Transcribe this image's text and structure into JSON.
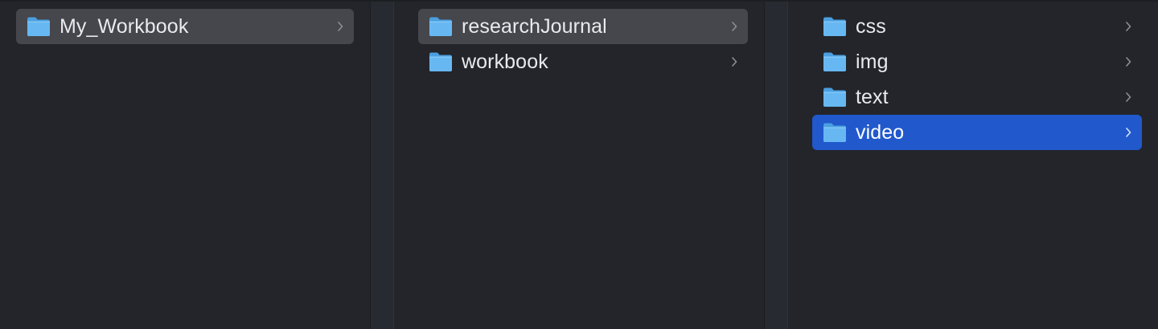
{
  "columns": [
    {
      "items": [
        {
          "label": "My_Workbook",
          "state": "selected-inactive"
        }
      ]
    },
    {
      "items": [
        {
          "label": "researchJournal",
          "state": "selected-inactive"
        },
        {
          "label": "workbook",
          "state": "normal"
        }
      ]
    },
    {
      "items": [
        {
          "label": "css",
          "state": "normal"
        },
        {
          "label": "img",
          "state": "normal"
        },
        {
          "label": "text",
          "state": "normal"
        },
        {
          "label": "video",
          "state": "selected-active"
        }
      ]
    }
  ],
  "colors": {
    "background": "#23252b",
    "selection_active": "#2159cc",
    "selection_inactive": "#45474c",
    "folder_icon": "#5fb3ef",
    "text": "#e9eaec"
  },
  "icons": {
    "folder": "folder-icon",
    "disclosure": "chevron-right-icon"
  }
}
